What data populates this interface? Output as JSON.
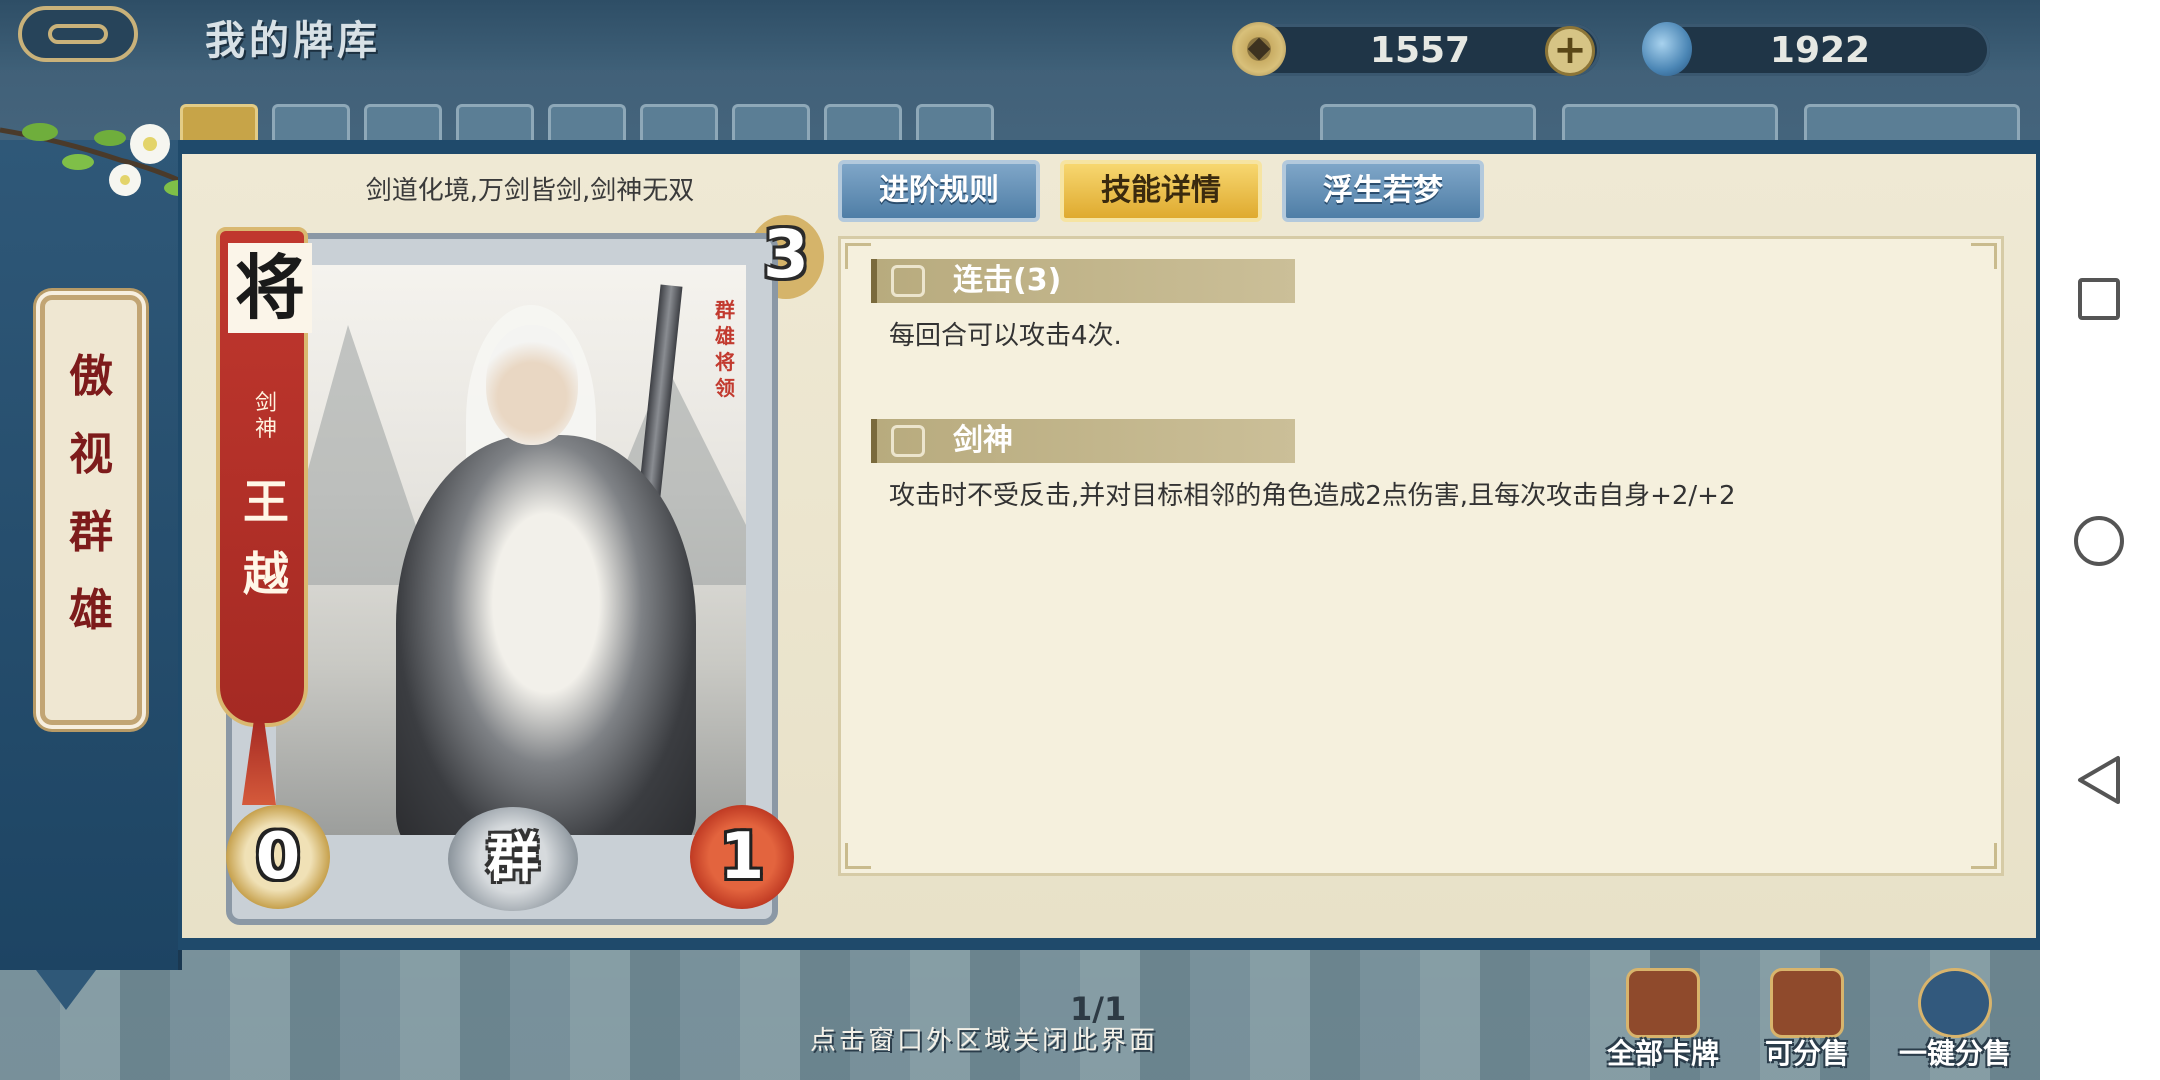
{
  "header": {
    "title": "我的牌库",
    "coins": "1557",
    "jade": "1922"
  },
  "sidebar": {
    "title_chars": [
      "傲",
      "视",
      "群",
      "雄"
    ]
  },
  "card": {
    "motto": "剑道化境,万剑皆剑,剑神无双",
    "type": "将",
    "subtitle_chars": [
      "剑",
      "神"
    ],
    "name_chars": [
      "王",
      "越"
    ],
    "faction_tag_chars": [
      "群",
      "雄",
      "将",
      "领"
    ],
    "cost": "3",
    "attack": "0",
    "faction": "群",
    "health": "1"
  },
  "tabs": [
    {
      "label": "进阶规则",
      "active": false
    },
    {
      "label": "技能详情",
      "active": true
    },
    {
      "label": "浮生若梦",
      "active": false
    }
  ],
  "skills": [
    {
      "name": "连击(3)",
      "description": "每回合可以攻击4次."
    },
    {
      "name": "剑神",
      "description": "攻击时不受反击,并对目标相邻的角色造成2点伤害,且每次攻击自身+2/+2"
    }
  ],
  "footer": {
    "pager": "1/1",
    "close_hint": "点击窗口外区域关闭此界面",
    "buttons": [
      "全部卡牌",
      "可分售",
      "一键分售"
    ]
  },
  "colors": {
    "accent_gold": "#dfaa2f",
    "panel_blue": "#1f4a6b",
    "card_red": "#c0372e"
  }
}
